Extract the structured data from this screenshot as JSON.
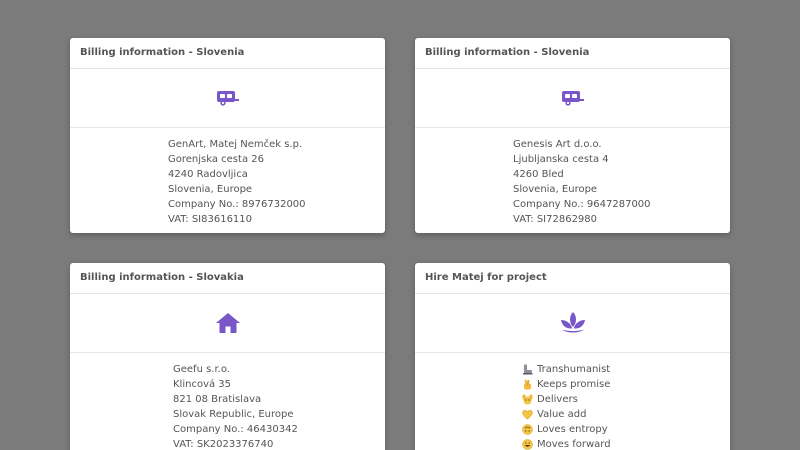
{
  "colors": {
    "background": "#7b7b7b",
    "card": "#ffffff",
    "accent": "#7a57c9",
    "text": "#555555"
  },
  "cards": [
    {
      "title": "Billing information - Slovenia",
      "icon": "caravan-icon",
      "lines": [
        "GenArt, Matej Nemček s.p.",
        "Gorenjska cesta 26",
        "4240 Radovljica",
        "Slovenia, Europe",
        "Company No.: 8976732000",
        "VAT: SI83616110"
      ]
    },
    {
      "title": "Billing information - Slovenia",
      "icon": "caravan-icon",
      "lines": [
        "Genesis Art d.o.o.",
        "Ljubljanska cesta 4",
        "4260 Bled",
        "Slovenia, Europe",
        "Company No.: 9647287000",
        "VAT: SI72862980"
      ]
    },
    {
      "title": "Billing information - Slovakia",
      "icon": "home-icon",
      "lines": [
        "Geefu s.r.o.",
        "Klincová 35",
        "821 08 Bratislava",
        "Slovak Republic, Europe",
        "Company No.: 46430342",
        "VAT: SK2023376740"
      ]
    },
    {
      "title": "Hire Matej for project",
      "icon": "lotus-icon",
      "traits": [
        {
          "icon": "mechanical-leg-icon",
          "label": "Transhumanist"
        },
        {
          "icon": "crossed-fingers-icon",
          "label": "Keeps promise"
        },
        {
          "icon": "raising-hands-icon",
          "label": "Delivers"
        },
        {
          "icon": "yellow-heart-icon",
          "label": "Value add"
        },
        {
          "icon": "upside-down-face-icon",
          "label": "Loves entropy"
        },
        {
          "icon": "grinning-face-icon",
          "label": "Moves forward"
        }
      ]
    }
  ]
}
